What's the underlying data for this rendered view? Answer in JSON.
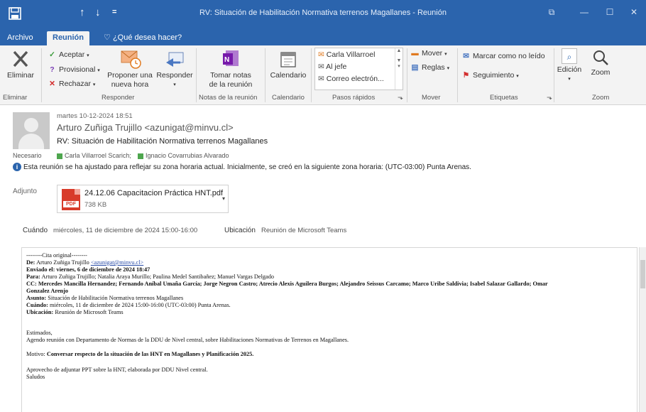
{
  "window": {
    "title": "RV: Situación de Habilitación Normativa terrenos Magallanes - Reunión",
    "quick_access": [
      "↑",
      "↓",
      "="
    ],
    "controls": [
      "⧉",
      "—",
      "☐",
      "✕"
    ]
  },
  "ribbon_tabs": [
    "Archivo",
    "Reunión",
    "¿Qué desea hacer?"
  ],
  "ribbon": {
    "eliminar": {
      "label": "Eliminar",
      "group": "Eliminar"
    },
    "responder_group": {
      "aceptar": "Aceptar",
      "provisional": "Provisional",
      "rechazar": "Rechazar",
      "proponer": [
        "Proponer una",
        "nueva hora"
      ],
      "responder": "Responder",
      "group": "Responder"
    },
    "notas": {
      "label": [
        "Tomar notas",
        "de la reunión"
      ],
      "group": "Notas de la reunión"
    },
    "calendario": {
      "label": "Calendario",
      "group": "Calendario"
    },
    "pasos": {
      "items": [
        "Carla Villarroel",
        "Al jefe",
        "Correo electrón..."
      ],
      "group": "Pasos rápidos"
    },
    "mover": {
      "mover": "Mover",
      "reglas": "Reglas",
      "group": "Mover"
    },
    "etiquetas": {
      "marcar": "Marcar como no leído",
      "seguimiento": "Seguimiento",
      "group": "Etiquetas"
    },
    "edicion": {
      "label": "Edición"
    },
    "zoom": {
      "label": "Zoom",
      "group": "Zoom"
    }
  },
  "header": {
    "date": "martes 10-12-2024 18:51",
    "from": "Arturo Zuñiga Trujillo <azunigat@minvu.cl>",
    "subject": "RV: Situación de Habilitación Normativa terrenos Magallanes",
    "required_label": "Necesario",
    "required": [
      "Carla Villarroel Scarich;",
      "Ignacio Covarrubias Alvarado"
    ],
    "info": "Esta reunión se ha ajustado para reflejar su zona horaria actual. Inicialmente, se creó en la siguiente zona horaria: (UTC-03:00) Punta Arenas.",
    "attachment_label": "Adjunto",
    "attachment": {
      "name": "24.12.06 Capacitacion Práctica HNT.pdf",
      "size": "738 KB",
      "type": "PDF"
    },
    "when_label": "Cuándo",
    "when": "miércoles, 11 de diciembre de 2024 15:00-16:00",
    "where_label": "Ubicación",
    "where": "Reunión de Microsoft Teams"
  },
  "body": {
    "original": "--------Cita original--------",
    "de_label": "De:",
    "de": "Arturo Zuñiga Trujillo",
    "de_email": "<azunigat@minvu.cl>",
    "enviado_label": "Enviado el:",
    "enviado": "viernes, 6 de diciembre de 2024 18:47",
    "para_label": "Para:",
    "para": "Arturo Zuñiga Trujillo; Natalia Araya Murillo; Paulina Medel Santibañez; Manuel Vargas Delgado",
    "cc_label": "CC:",
    "cc1": "Mercedes Mancilla Hernandez; Fernando Aníbal Umaña García; Jorge Negron Castro; Atrecio Alexis Aguilera Burgos; Alejandro Seissus Carcamo; Marco Uribe Saldivia; Isabel Salazar Gallardo; Omar",
    "cc2": "Gonzalez Arenjo",
    "asunto_label": "Asunto:",
    "asunto": "Situación de Habilitación Normativa terrenos Magallanes",
    "cuando_label": "Cuándo:",
    "cuando": "miércoles, 11 de diciembre de 2024 15:00-16:00 (UTC-03:00) Punta Arenas.",
    "ubicacion_label": "Ubicación:",
    "ubicacion": "Reunión de Microsoft Teams",
    "estimados": "Estimados,",
    "p1": "Agendo reunión con Departamento de Normas de la DDU de Nivel central, sobre Habilitaciones Normativas de Terrenos en Magallanes.",
    "motivo_label": "Motivo:",
    "motivo": "Conversar respecto de la situación de las HNT en Magallanes y Planificación 2025.",
    "p2": "Aprovecho de adjuntar PPT sobre la HNT, elaborada por DDU Nivel central.",
    "saludos": "Saludos"
  },
  "colors": {
    "title_bar": "#2b64ad",
    "ribbon_bg": "#f3f3f3",
    "attendee_green": "#4ea64e",
    "pdf_red": "#d83b2a",
    "delete_red": "#d32f2f",
    "accept_green": "#3a9b3a"
  }
}
